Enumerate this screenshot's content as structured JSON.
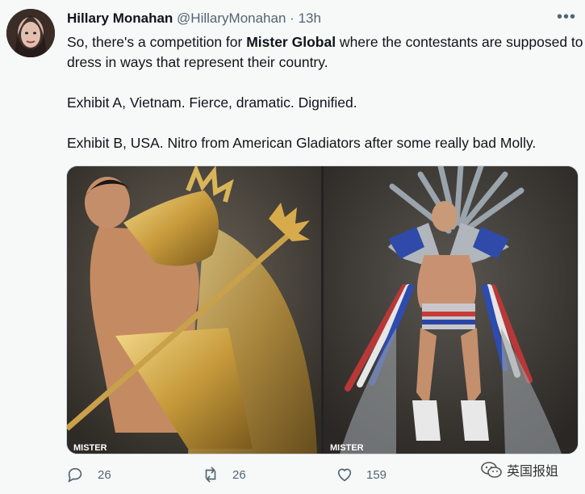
{
  "tweet": {
    "display_name": "Hillary Monahan",
    "handle": "@HillaryMonahan",
    "separator": "·",
    "time": "13h",
    "more_icon": "more-icon",
    "body": {
      "line1_pre": "So, there's a competition for ",
      "line1_bold": "Mister Global",
      "line1_post": " where the contestants are supposed to dress in ways that represent their country.",
      "line2": "Exhibit A, Vietnam. Fierce, dramatic. Dignified.",
      "line3": "Exhibit B, USA. Nitro from American Gladiators after some really bad Molly."
    },
    "media": {
      "left_photo_watermark": "MISTER",
      "right_photo_watermark": "MISTER"
    },
    "actions": {
      "replies": "26",
      "retweets": "26",
      "likes": "159"
    }
  },
  "watermark": {
    "label": "英国报姐",
    "icon": "wechat-icon"
  }
}
